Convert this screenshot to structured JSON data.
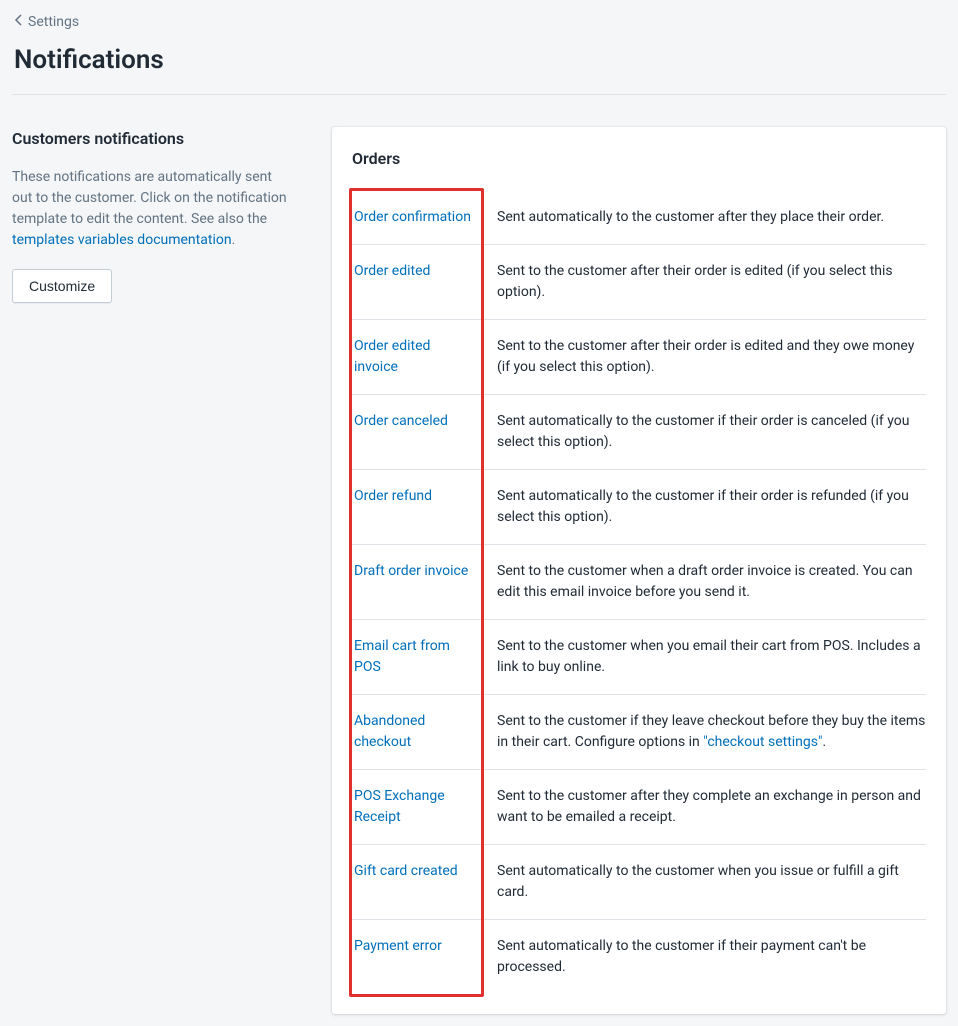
{
  "breadcrumb": {
    "label": "Settings"
  },
  "page": {
    "title": "Notifications"
  },
  "sidebar": {
    "heading": "Customers notifications",
    "description_pre": "These notifications are automatically sent out to the customer. Click on the notification template to edit the content. See also the ",
    "description_link": "templates variables documentation",
    "description_post": ".",
    "customize_button": "Customize"
  },
  "card": {
    "heading": "Orders"
  },
  "notifications": [
    {
      "name": "Order confirmation",
      "description": "Sent automatically to the customer after they place their order."
    },
    {
      "name": "Order edited",
      "description": "Sent to the customer after their order is edited (if you select this option)."
    },
    {
      "name": "Order edited invoice",
      "description": "Sent to the customer after their order is edited and they owe money (if you select this option)."
    },
    {
      "name": "Order canceled",
      "description": "Sent automatically to the customer if their order is canceled (if you select this option)."
    },
    {
      "name": "Order refund",
      "description": "Sent automatically to the customer if their order is refunded (if you select this option)."
    },
    {
      "name": "Draft order invoice",
      "description": "Sent to the customer when a draft order invoice is created. You can edit this email invoice before you send it."
    },
    {
      "name": "Email cart from POS",
      "description": "Sent to the customer when you email their cart from POS. Includes a link to buy online."
    },
    {
      "name": "Abandoned checkout",
      "description_pre": "Sent to the customer if they leave checkout before they buy the items in their cart. Configure options in ",
      "description_link": "\"checkout settings\"",
      "description_post": "."
    },
    {
      "name": "POS Exchange Receipt",
      "description": "Sent to the customer after they complete an exchange in person and want to be emailed a receipt."
    },
    {
      "name": "Gift card created",
      "description": "Sent automatically to the customer when you issue or fulfill a gift card."
    },
    {
      "name": "Payment error",
      "description": "Sent automatically to the customer if their payment can't be processed."
    }
  ]
}
